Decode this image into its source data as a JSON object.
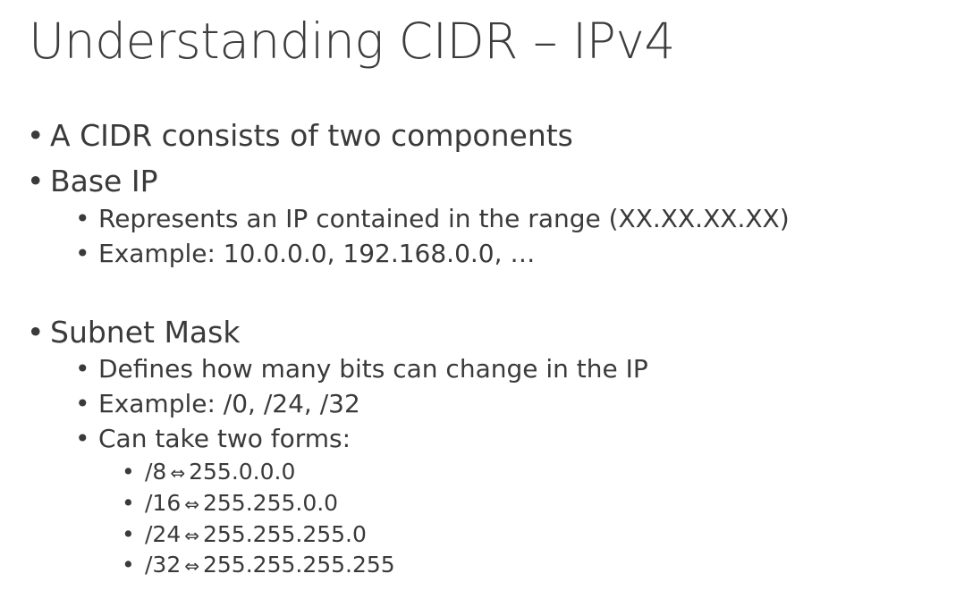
{
  "slide": {
    "title": "Understanding CIDR – IPv4",
    "bullet_glyph": "•",
    "arrow_glyph": "⇔",
    "items": {
      "intro": "A CIDR consists of two components",
      "base_ip": {
        "heading": "Base IP",
        "sub": [
          "Represents an IP contained in the range (XX.XX.XX.XX)",
          "Example: 10.0.0.0, 192.168.0.0, …"
        ]
      },
      "subnet_mask": {
        "heading": "Subnet Mask",
        "sub": [
          "Defines how many bits can change in the IP",
          "Example: /0, /24, /32",
          "Can take two forms:"
        ],
        "forms": [
          {
            "cidr": "/8",
            "mask": "255.0.0.0"
          },
          {
            "cidr": "/16",
            "mask": "255.255.0.0"
          },
          {
            "cidr": "/24",
            "mask": "255.255.255.0"
          },
          {
            "cidr": "/32",
            "mask": "255.255.255.255"
          }
        ]
      }
    }
  }
}
